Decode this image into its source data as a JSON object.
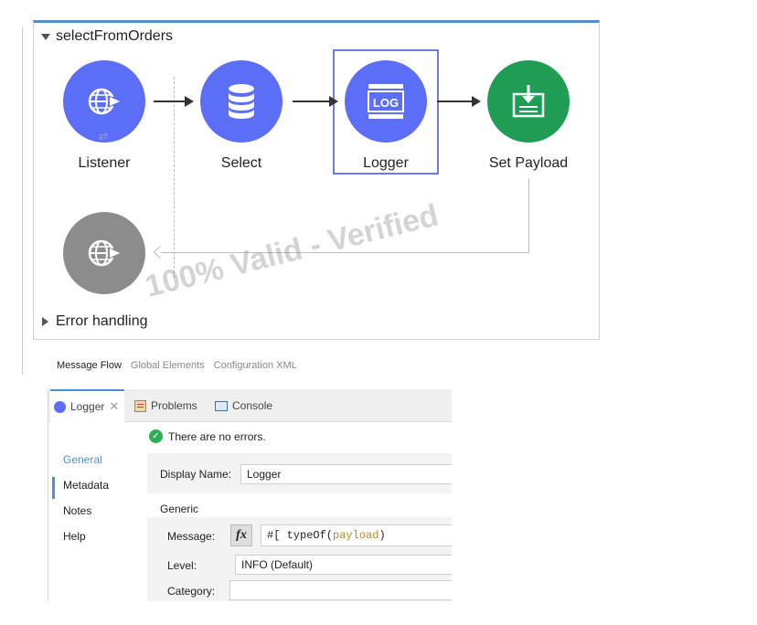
{
  "flow": {
    "name": "selectFromOrders",
    "nodes": [
      {
        "label": "Listener",
        "icon": "globe-arrow-icon",
        "color": "#5b6ef5"
      },
      {
        "label": "Select",
        "icon": "database-icon",
        "color": "#5b6ef5"
      },
      {
        "label": "Logger",
        "icon": "log-icon",
        "color": "#5b6ef5",
        "selected": true
      },
      {
        "label": "Set Payload",
        "icon": "set-payload-icon",
        "color": "#1f9d55"
      }
    ],
    "source_icon": "globe-arrow-icon",
    "log_icon_text": "LOG",
    "error_handling_label": "Error handling"
  },
  "watermark": "100% Valid - Verified",
  "view_tabs": [
    "Message Flow",
    "Global Elements",
    "Configuration XML"
  ],
  "editor_tabs": [
    {
      "label": "Logger",
      "icon": "logger-dot-icon"
    },
    {
      "label": "Problems",
      "icon": "problems-icon"
    },
    {
      "label": "Console",
      "icon": "console-icon"
    }
  ],
  "side_nav": [
    "General",
    "Metadata",
    "Notes",
    "Help"
  ],
  "status": "There are no errors.",
  "form": {
    "display_name_label": "Display Name:",
    "display_name_value": "Logger",
    "generic_label": "Generic",
    "message_label": "Message:",
    "fx_label": "fx",
    "message_prefix": "#[ typeOf(",
    "message_keyword": "payload",
    "message_suffix": ")",
    "level_label": "Level:",
    "level_value": "INFO (Default)",
    "category_label": "Category:",
    "category_value": ""
  },
  "colors": {
    "accent": "#4a90d9",
    "mule_blue": "#5b6ef5",
    "mule_green": "#1f9d55",
    "keyword": "#c0862a"
  }
}
